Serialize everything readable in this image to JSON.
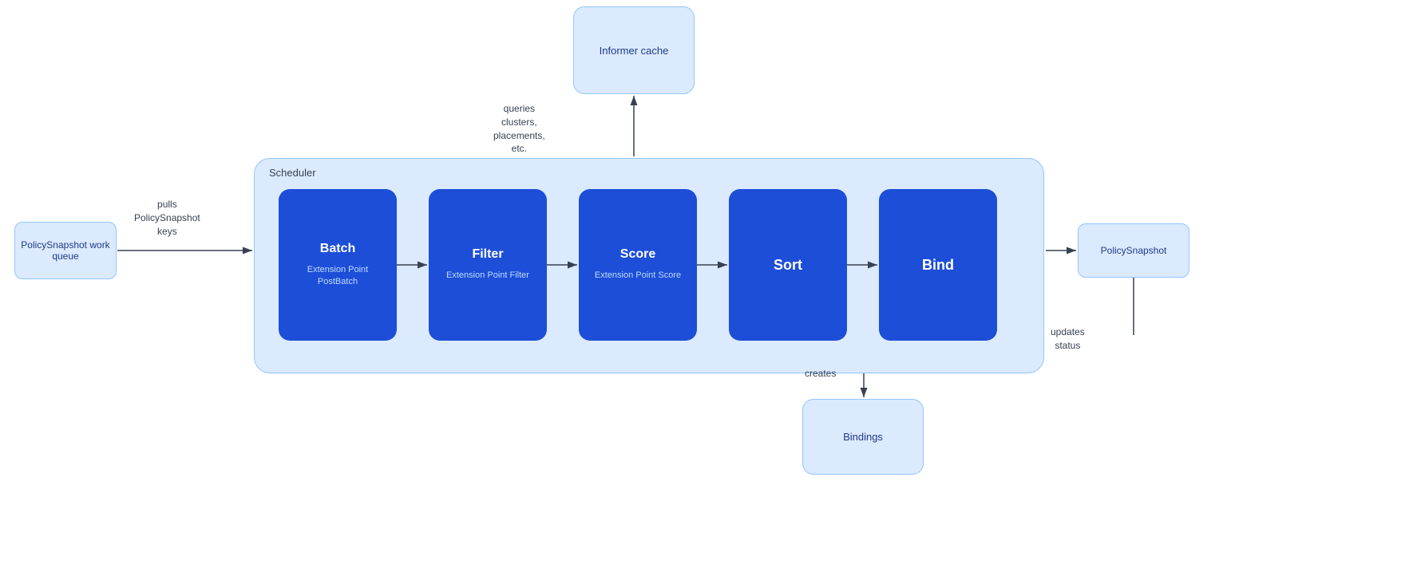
{
  "informerCache": {
    "label": "Informer cache"
  },
  "policySnapshotQueue": {
    "label": "PolicySnapshot work queue"
  },
  "policySnapshotOutput": {
    "label": "PolicySnapshot"
  },
  "bindings": {
    "label": "Bindings"
  },
  "scheduler": {
    "label": "Scheduler"
  },
  "steps": {
    "batch": {
      "title": "Batch",
      "subtitle": "Extension Point PostBatch"
    },
    "filter": {
      "title": "Filter",
      "subtitle": "Extension Point Filter"
    },
    "score": {
      "title": "Score",
      "subtitle": "Extension Point Score"
    },
    "sort": {
      "title": "Sort"
    },
    "bind": {
      "title": "Bind"
    }
  },
  "labels": {
    "pulls": "pulls\nPolicySnapshot\nkeys",
    "queries": "queries\nclusters,\nplacements,\netc.",
    "creates": "creates",
    "updates": "updates\nstatus"
  }
}
